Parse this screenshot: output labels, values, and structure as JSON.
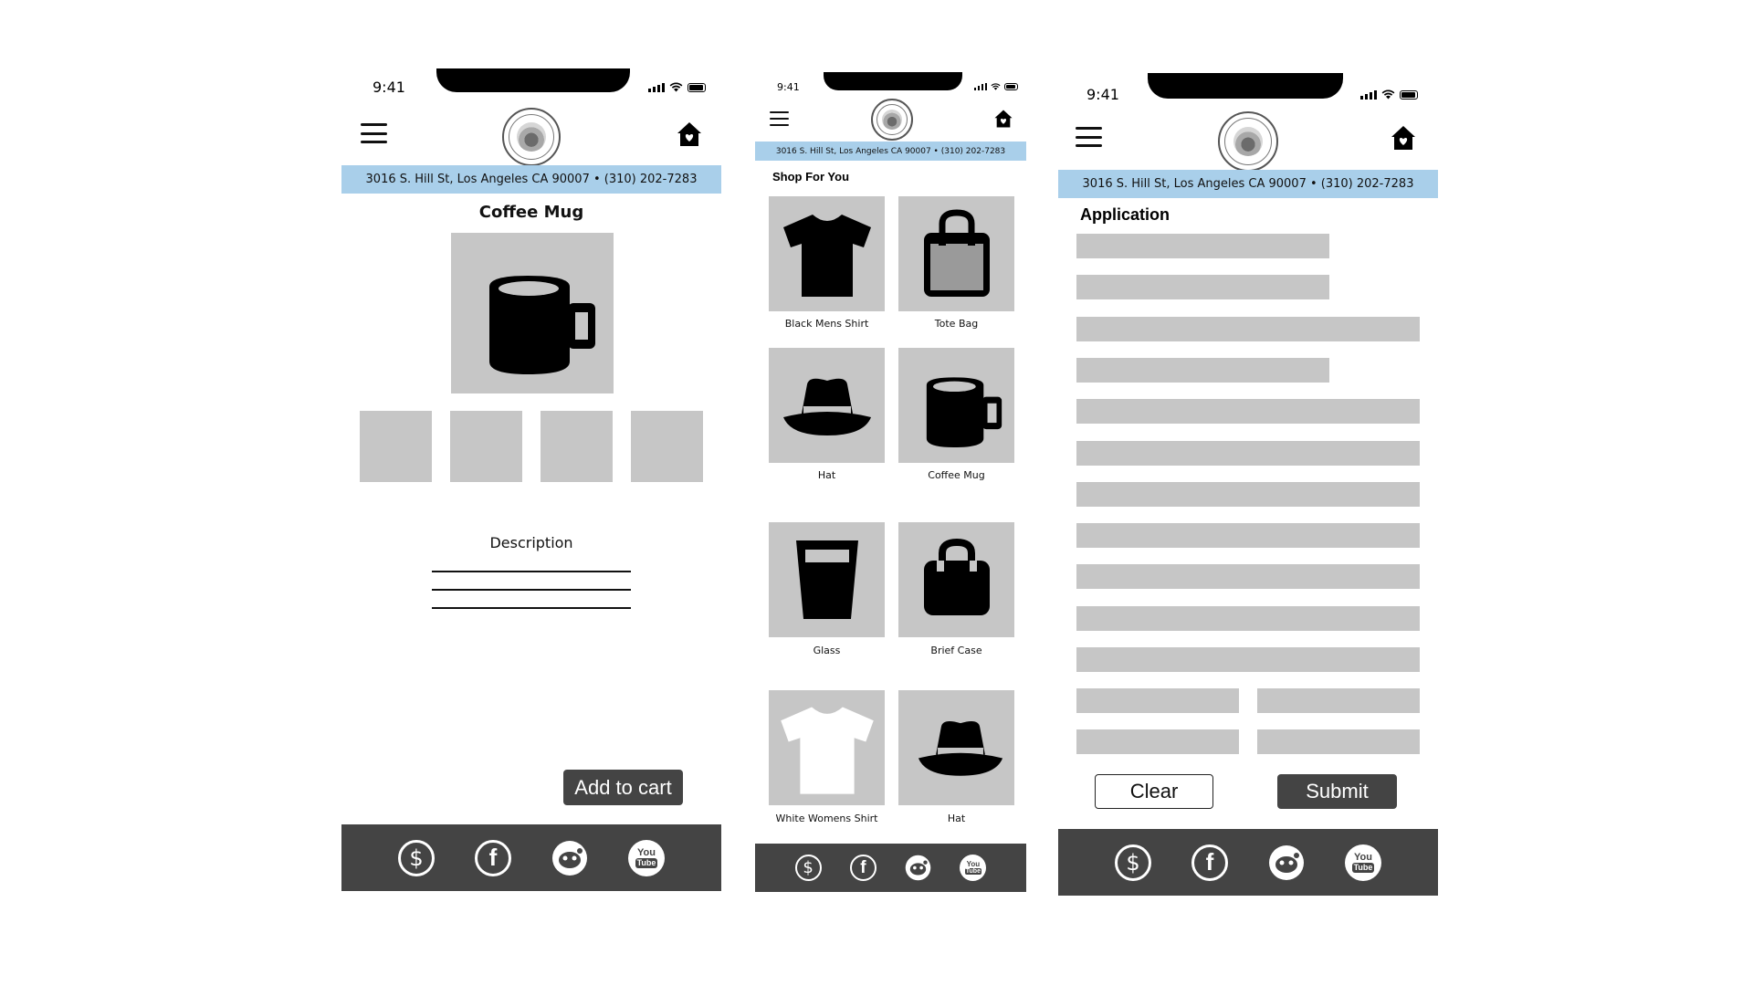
{
  "status_bar": {
    "time": "9:41"
  },
  "header": {
    "address": "3016 S. Hill St, Los Angeles CA 90007 •  (310) 202-7283"
  },
  "product_screen": {
    "title": "Coffee Mug",
    "description_label": "Description",
    "add_to_cart_label": "Add to cart"
  },
  "shop_screen": {
    "section_title": "Shop For You",
    "products": [
      {
        "name": "Black Mens Shirt",
        "icon": "black-shirt-icon"
      },
      {
        "name": "Tote Bag",
        "icon": "tote-bag-icon"
      },
      {
        "name": "Hat",
        "icon": "hat-icon"
      },
      {
        "name": "Coffee Mug",
        "icon": "coffee-mug-icon"
      },
      {
        "name": "Glass",
        "icon": "glass-icon"
      },
      {
        "name": "Brief Case",
        "icon": "brief-case-icon"
      },
      {
        "name": "White Womens Shirt",
        "icon": "white-shirt-icon"
      },
      {
        "name": "Hat",
        "icon": "hat-icon"
      }
    ]
  },
  "application_screen": {
    "title": "Application",
    "clear_label": "Clear",
    "submit_label": "Submit"
  },
  "footer_icons": [
    "dollar-icon",
    "facebook-icon",
    "reddit-icon",
    "youtube-icon"
  ],
  "youtube_text": {
    "top": "You",
    "bottom": "Tube"
  },
  "colors": {
    "address_bar": "#a9cfea",
    "footer": "#444444",
    "placeholder": "#c6c6c6",
    "button_dark": "#444444"
  }
}
